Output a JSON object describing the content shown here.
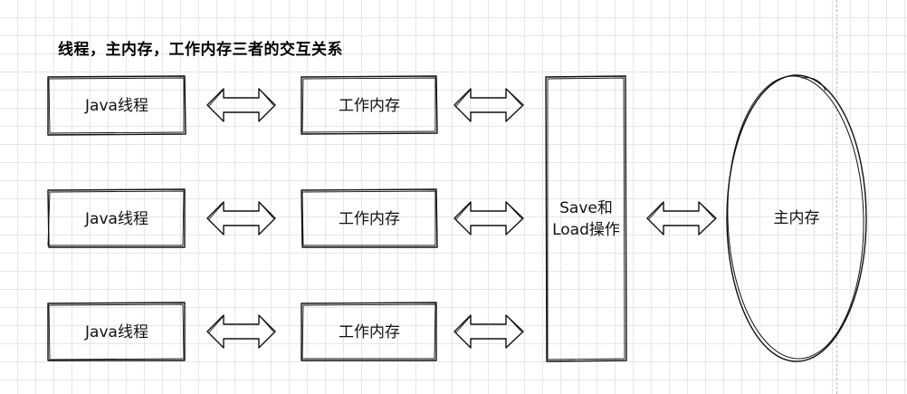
{
  "title": "线程，主内存，工作内存三者的交互关系",
  "threads": [
    "Java线程",
    "Java线程",
    "Java线程"
  ],
  "work_memory": [
    "工作内存",
    "工作内存",
    "工作内存"
  ],
  "save_load_line1": "Save和",
  "save_load_line2": "Load操作",
  "main_memory": "主内存",
  "colors": {
    "stroke": "#111111",
    "grid": "#e6e6e6",
    "background": "#ffffff"
  }
}
